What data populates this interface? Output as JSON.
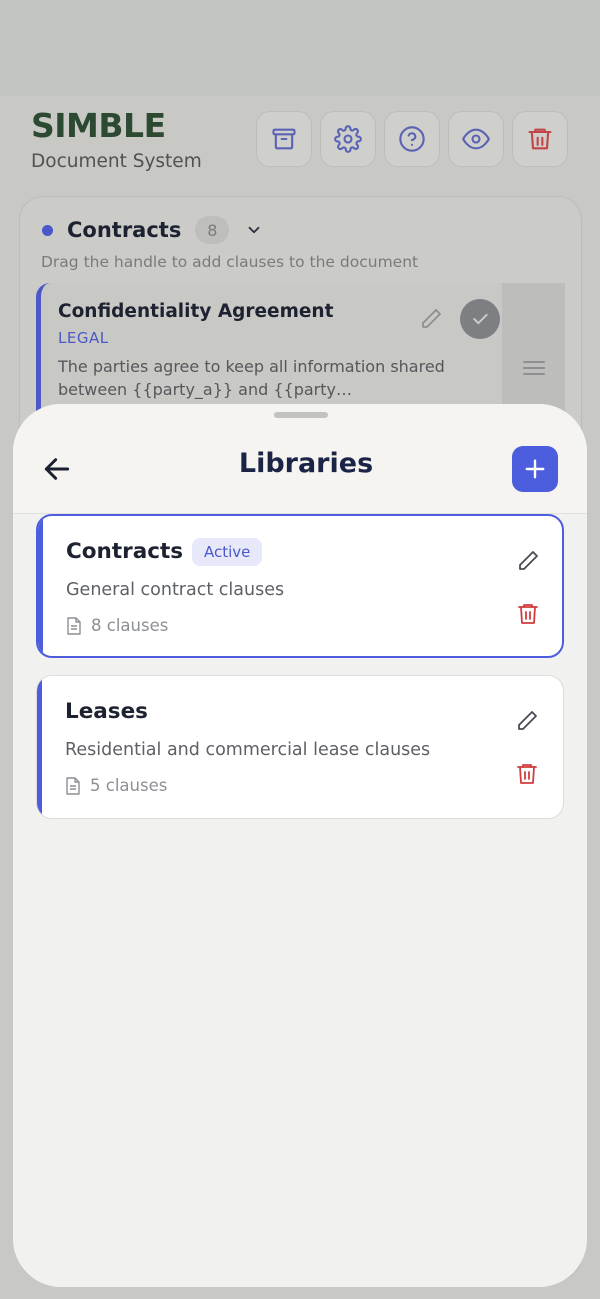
{
  "app": {
    "brand": "SIMBLE",
    "subtitle": "Document System"
  },
  "toolbar": {
    "buttons": [
      {
        "name": "archive",
        "icon": "archive-icon"
      },
      {
        "name": "settings",
        "icon": "gear-icon"
      },
      {
        "name": "help",
        "icon": "help-circle-icon"
      },
      {
        "name": "preview",
        "icon": "eye-icon"
      },
      {
        "name": "delete",
        "icon": "trash-icon"
      }
    ]
  },
  "library_panel": {
    "name": "Contracts",
    "count": "8",
    "hint": "Drag the handle to add clauses to the document",
    "clause": {
      "title": "Confidentiality Agreement",
      "category": "LEGAL",
      "body": "The parties agree to keep all information shared between {{party_a}} and {{party…"
    }
  },
  "sheet": {
    "title": "Libraries",
    "items": [
      {
        "title": "Contracts",
        "badge": "Active",
        "description": "General contract clauses",
        "meta": "8 clauses",
        "active": true
      },
      {
        "title": "Leases",
        "badge": "",
        "description": "Residential and commercial lease clauses",
        "meta": "5 clauses",
        "active": false
      }
    ]
  },
  "colors": {
    "accent": "#4c5ddd",
    "brand": "#2c4a31",
    "danger": "#d23c3c"
  }
}
